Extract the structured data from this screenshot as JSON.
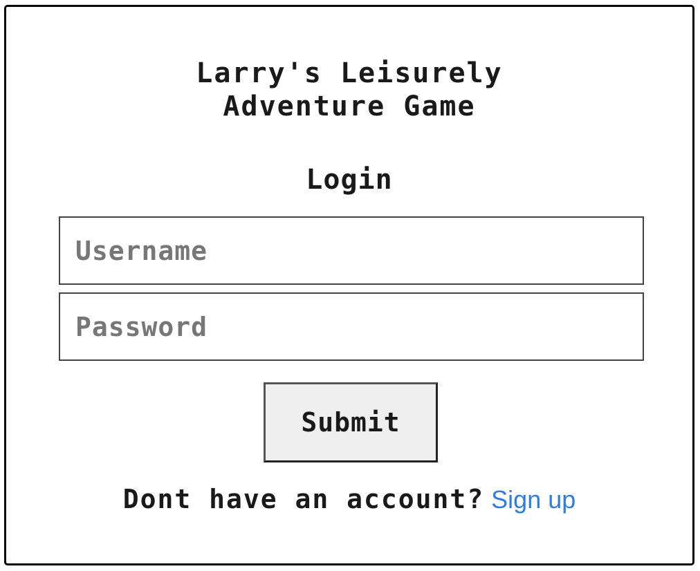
{
  "header": {
    "title_line1": "Larry's Leisurely",
    "title_line2": "Adventure Game"
  },
  "form": {
    "heading": "Login",
    "username": {
      "placeholder": "Username",
      "value": ""
    },
    "password": {
      "placeholder": "Password",
      "value": ""
    },
    "submit_label": "Submit"
  },
  "footer": {
    "prompt": "Dont have an account?",
    "signup_label": "Sign up"
  },
  "colors": {
    "link": "#2f7de1",
    "text": "#1a1a1a",
    "button_bg": "#efefef"
  }
}
